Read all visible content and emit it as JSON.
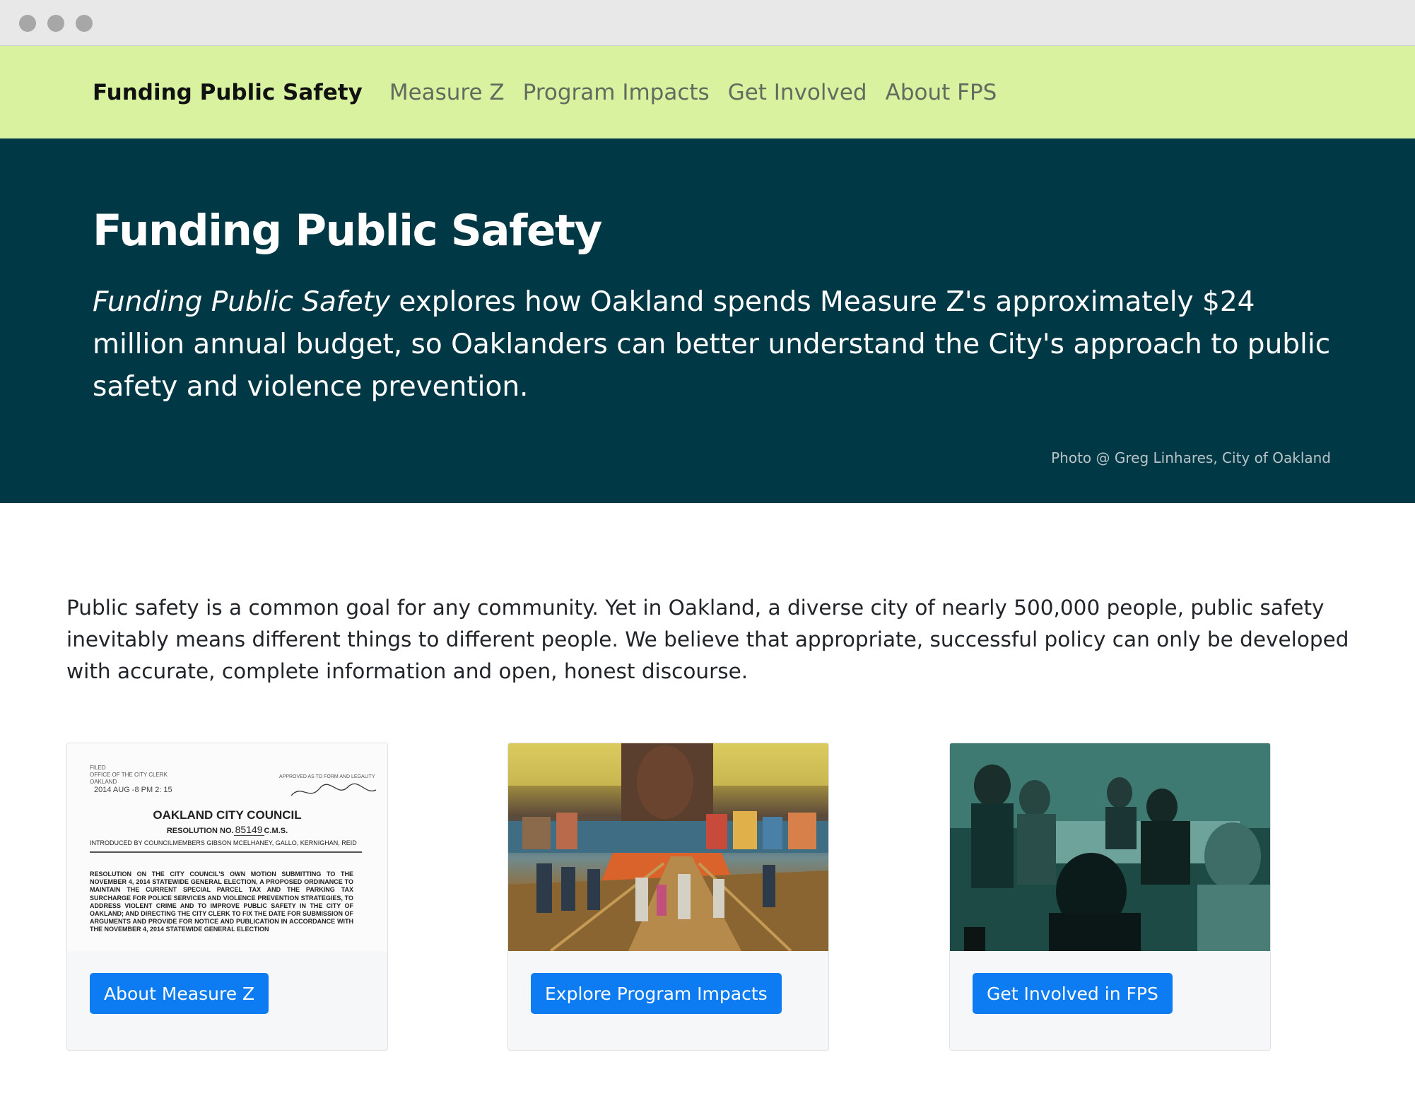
{
  "navbar": {
    "brand": "Funding Public Safety",
    "links": [
      {
        "label": "Measure Z"
      },
      {
        "label": "Program Impacts"
      },
      {
        "label": "Get Involved"
      },
      {
        "label": "About FPS"
      }
    ]
  },
  "hero": {
    "title": "Funding Public Safety",
    "lead_em": "Funding Public Safety",
    "lead_rest": " explores how Oakland spends Measure Z's approximately $24 million annual budget, so Oaklanders can better understand the City's approach to public safety and violence prevention.",
    "photo_credit": "Photo @ Greg Linhares, City of Oakland"
  },
  "intro": "Public safety is a common goal for any community. Yet in Oakland, a diverse city of nearly 500,000 people, public safety inevitably means different things to different people. We believe that appropriate, successful policy can only be developed with accurate, complete information and open, honest discourse.",
  "cards": [
    {
      "button": "About Measure Z",
      "image": {
        "stamp": "FILED\nOFFICE OF THE CITY CLERK\nOAKLAND",
        "stamp_date": "2014 AUG -8  PM 2: 15",
        "approved": "APPROVED AS TO FORM AND LEGALITY",
        "council": "OAKLAND CITY COUNCIL",
        "resolution_prefix": "RESOLUTION NO.",
        "resolution_no": "85149",
        "resolution_suffix": "C.M.S.",
        "introduced": "INTRODUCED BY COUNCILMEMBERS GIBSON MCELHANEY, GALLO, KERNIGHAN, REID",
        "body": "RESOLUTION ON THE CITY COUNCIL'S OWN MOTION SUBMITTING TO THE NOVEMBER 4, 2014 STATEWIDE GENERAL ELECTION, A PROPOSED ORDINANCE TO MAINTAIN THE CURRENT SPECIAL PARCEL TAX AND THE PARKING TAX SURCHARGE FOR POLICE SERVICES AND VIOLENCE PREVENTION STRATEGIES, TO ADDRESS VIOLENT CRIME AND TO IMPROVE PUBLIC SAFETY IN THE CITY OF OAKLAND; AND DIRECTING THE CITY CLERK TO FIX THE DATE FOR SUBMISSION OF ARGUMENTS AND PROVIDE FOR NOTICE AND PUBLICATION IN ACCORDANCE WITH THE NOVEMBER 4, 2014 STATEWIDE GENERAL ELECTION"
      }
    },
    {
      "button": "Explore Program Impacts"
    },
    {
      "button": "Get Involved in FPS"
    }
  ],
  "colors": {
    "navbar_bg": "#d9f2a0",
    "hero_bg": "#013845",
    "button_bg": "#0d7cf2"
  }
}
